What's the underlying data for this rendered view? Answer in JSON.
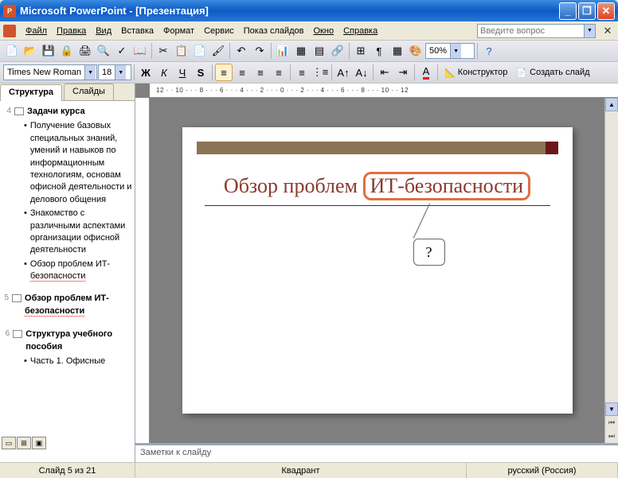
{
  "window": {
    "title": "Microsoft PowerPoint - [Презентация]"
  },
  "menu": {
    "items": [
      "Файл",
      "Правка",
      "Вид",
      "Вставка",
      "Формат",
      "Сервис",
      "Показ слайдов",
      "Окно",
      "Справка"
    ],
    "help_placeholder": "Введите вопрос"
  },
  "toolbar1": {
    "zoom": "50%"
  },
  "toolbar2": {
    "font": "Times New Roman",
    "size": "18",
    "designer": "Конструктор",
    "new_slide": "Создать слайд"
  },
  "tabs": {
    "structure": "Структура",
    "slides": "Слайды"
  },
  "outline": {
    "s4": {
      "num": "4",
      "title": "Задачи курса",
      "bullets": [
        "Получение базовых специальных знаний, умений и навыков по информационным технологиям, основам офисной деятельности и делового общения",
        "Знакомство с различными аспектами организации офисной деятельности",
        "Обзор проблем ИТ-безопасности"
      ]
    },
    "s5": {
      "num": "5",
      "title": "Обзор проблем ИТ-безопасности"
    },
    "s6": {
      "num": "6",
      "title": "Структура учебного пособия",
      "bullet": "Часть 1. Офисные"
    }
  },
  "ruler": "12 · · 10 · · · 8 · · · 6 · · · 4 · · · 2 · · · 0 · · · 2 · · · 4 · · · 6 · · · 8 · · · 10 · · 12",
  "slide": {
    "title_prefix": "Обзор проблем ",
    "title_highlight": "ИТ-безопасности",
    "callout": "?"
  },
  "notes": {
    "label": "Заметки к слайду"
  },
  "status": {
    "slide": "Слайд 5 из 21",
    "layout": "Квадрант",
    "lang": "русский (Россия)"
  }
}
